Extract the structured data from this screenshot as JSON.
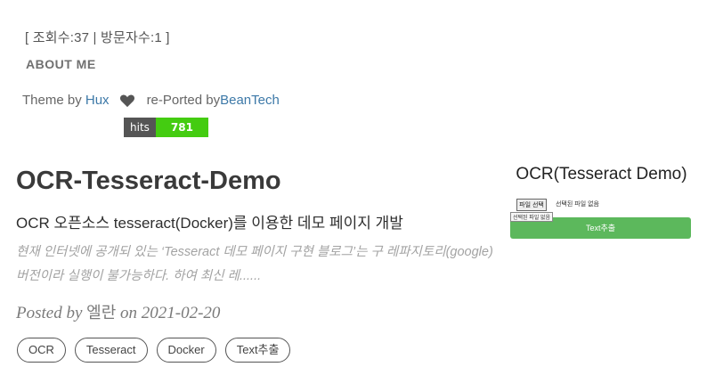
{
  "footer": {
    "counter": "[ 조회수:37 | 방문자수:1 ]",
    "about": "ABOUT ME",
    "theme_prefix": "Theme by ",
    "theme_author": "Hux",
    "ported_prefix": "re-Ported by ",
    "ported_author": "BeanTech",
    "hits_label": "hits",
    "hits_value": "781"
  },
  "post": {
    "title": "OCR-Tesseract-Demo",
    "subtitle": "OCR 오픈소스 tesseract(Docker)를 이용한 데모 페이지 개발",
    "excerpt": "현재 인터넷에 공개되 있는 ‘Tesseract 데모 페이지 구현 블로그’는 구 레파지토리(google) 버전이라 실행이 불가능하다. 하여 최신 레......",
    "posted_by": "Posted by",
    "author": "엘란",
    "date_prefix": "on",
    "date": "2021-02-20",
    "tags": [
      "OCR",
      "Tesseract",
      "Docker",
      "Text추출"
    ]
  },
  "preview": {
    "title": "OCR(Tesseract Demo)",
    "file_button": "파일 선택",
    "file_sub": "선택된 파일 없음",
    "file_text": "선택된 파일 없음",
    "action_button": "Text추출"
  },
  "colors": {
    "link": "#3d79a8",
    "hits_label_bg": "#555555",
    "hits_value_bg": "#44cc11",
    "button_green": "#5cb85c"
  },
  "icons": {
    "heart": "heart-icon"
  }
}
